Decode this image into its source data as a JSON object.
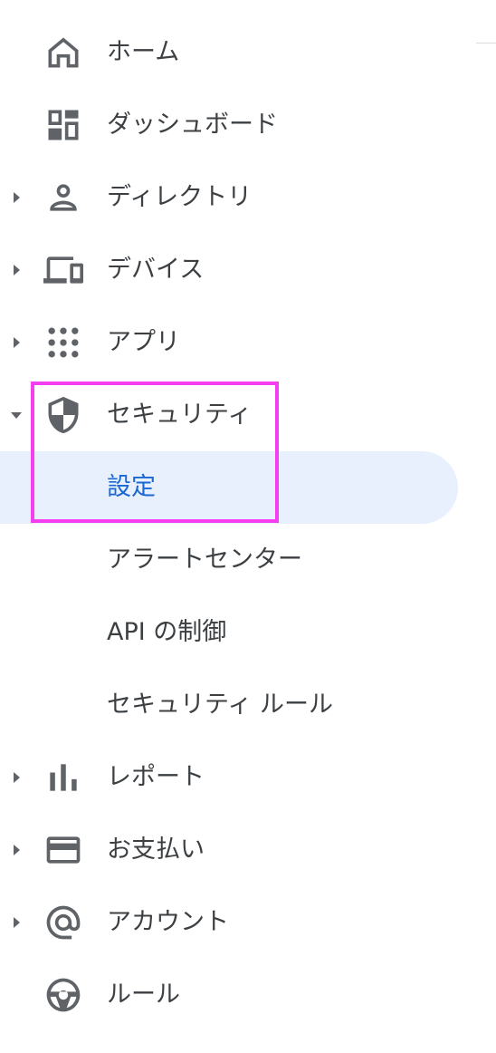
{
  "colors": {
    "text": "#3c4043",
    "icon": "#5f6368",
    "active_text": "#1967d2",
    "active_bg": "#e8f0fe",
    "highlight_border": "#f53ef0"
  },
  "nav": {
    "items": [
      {
        "label": "ホーム",
        "icon": "home-icon"
      },
      {
        "label": "ダッシュボード",
        "icon": "dashboard-icon"
      },
      {
        "label": "ディレクトリ",
        "icon": "person-icon",
        "expandable": true
      },
      {
        "label": "デバイス",
        "icon": "devices-icon",
        "expandable": true
      },
      {
        "label": "アプリ",
        "icon": "apps-grid-icon",
        "expandable": true
      },
      {
        "label": "セキュリティ",
        "icon": "shield-icon",
        "expandable": true,
        "expanded": true
      },
      {
        "label": "設定",
        "sub": true,
        "active": true
      },
      {
        "label": "アラートセンター",
        "sub": true
      },
      {
        "label": "API の制御",
        "sub": true
      },
      {
        "label": "セキュリティ ルール",
        "sub": true
      },
      {
        "label": "レポート",
        "icon": "bar-chart-icon",
        "expandable": true
      },
      {
        "label": "お支払い",
        "icon": "credit-card-icon",
        "expandable": true
      },
      {
        "label": "アカウント",
        "icon": "at-sign-icon",
        "expandable": true
      },
      {
        "label": "ルール",
        "icon": "rules-icon"
      }
    ]
  }
}
